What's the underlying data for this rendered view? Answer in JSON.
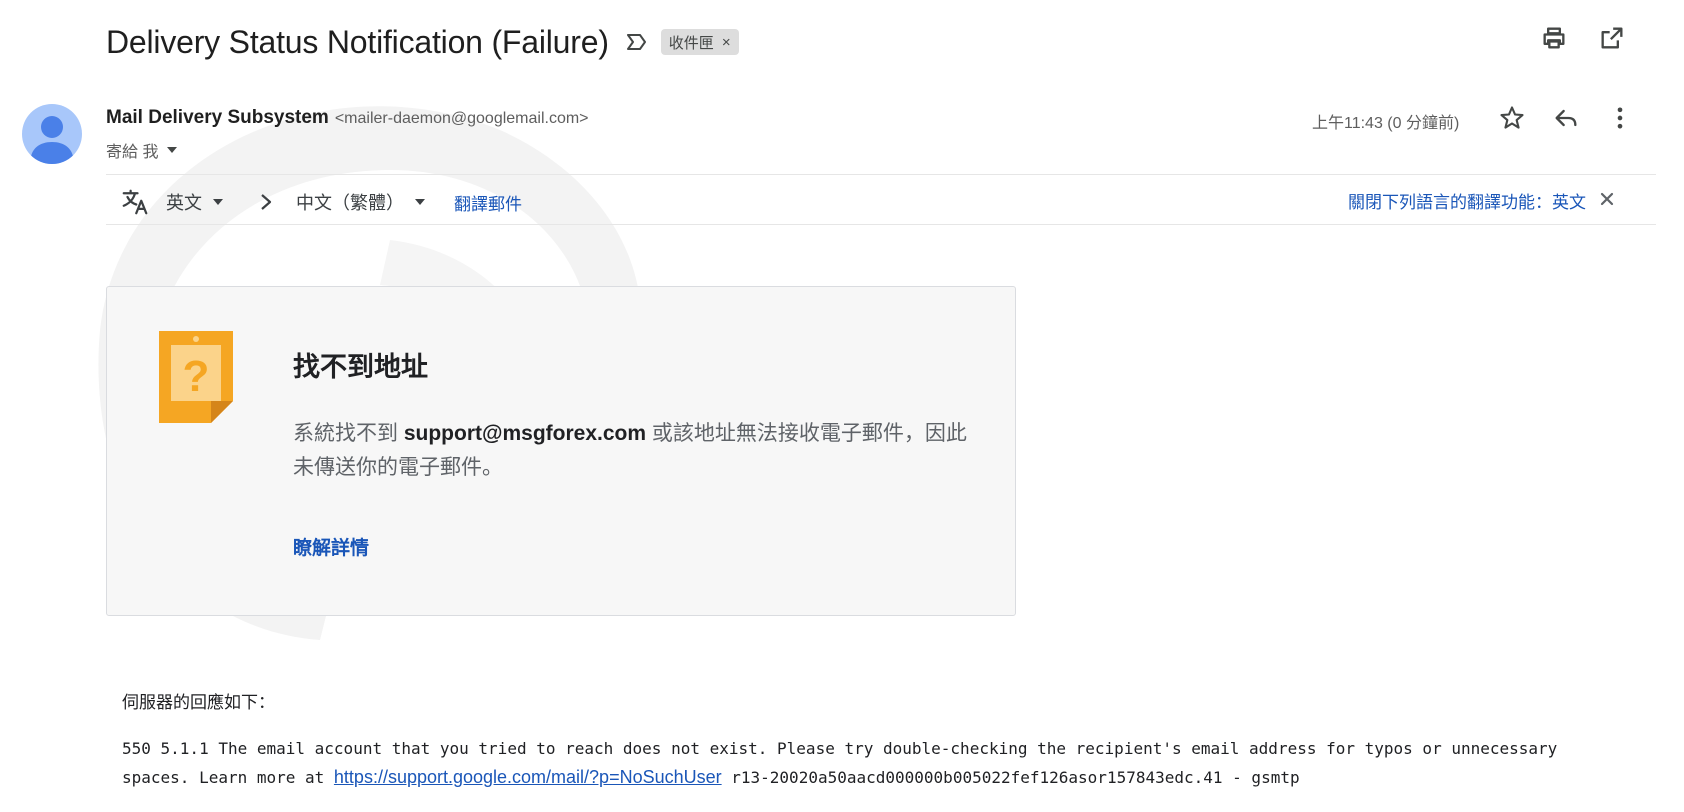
{
  "header": {
    "subject": "Delivery Status Notification (Failure)",
    "label": "收件匣",
    "label_remove": "×",
    "important_icon": "important-marker-icon",
    "print_icon": "print-icon",
    "open_new_window_icon": "open-in-new-icon"
  },
  "sender": {
    "name": "Mail Delivery Subsystem",
    "email": "<mailer-daemon@googlemail.com>",
    "to": "寄給 我",
    "time": "上午11:43 (0 分鐘前)",
    "avatar_icon": "person-icon",
    "star_icon": "star-icon",
    "reply_icon": "reply-icon",
    "more_icon": "more-vert-icon"
  },
  "translate": {
    "source_lang": "英文",
    "target_lang": "中文（繁體）",
    "translate_link": "翻譯郵件",
    "turn_off": "關閉下列語言的翻譯功能：英文",
    "close": "×",
    "translate_icon": "translate-icon",
    "arrow_icon": "chevron-right-icon"
  },
  "card": {
    "title": "找不到地址",
    "body_prefix": "系統找不到 ",
    "address": "support@msgforex.com",
    "body_suffix": " 或該地址無法接收電子郵件，因此未傳送你的電子郵件。",
    "learn_more": "瞭解詳情",
    "icon": "question-note-icon"
  },
  "server": {
    "heading": "伺服器的回應如下：",
    "message_prefix": "550 5.1.1 The email account that you tried to reach does not exist. Please try double-checking the recipient's email address for typos or unnecessary spaces. Learn more at ",
    "link": "https://support.google.com/mail/?p=NoSuchUser",
    "message_suffix": " r13-20020a50aacd000000b005022fef126asor157843edc.41 - gsmtp"
  },
  "colors": {
    "link": "#1a56b8",
    "avatar_bg": "#a8c7fa",
    "avatar_fg": "#4a80e8",
    "card_bg": "#f7f7f7",
    "note_orange": "#f5a623"
  }
}
